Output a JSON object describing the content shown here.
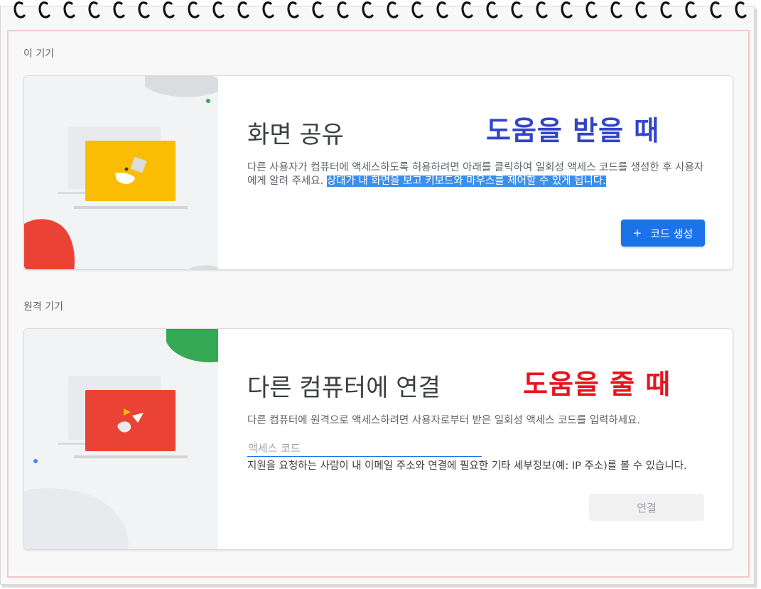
{
  "this_device": {
    "section_label": "이 기기",
    "title": "화면 공유",
    "annotation": "도움을 받을 때",
    "annotation_color": "#3344c8",
    "description": "다른 사용자가 컴퓨터에 액세스하도록 허용하려면 아래를 클릭하여 일회성 액세스 코드를 생성한 후 사용자에게 알려 주세요.",
    "description_highlight": "상대가 내 화면을 보고 키보드와 마우스를 제어할 수 있게 됩니다.",
    "button_icon": "+",
    "button_label": "코드 생성",
    "illustration_icon": "screen-share-laptop-icon",
    "illustration_accent": "#fbbc04"
  },
  "remote_device": {
    "section_label": "원격 기기",
    "title": "다른 컴퓨터에 연결",
    "annotation": "도움을 줄 때",
    "annotation_color": "#e8141c",
    "description": "다른 컴퓨터에 원격으로 액세스하려면 사용자로부터 받은 일회성 액세스 코드를 입력하세요.",
    "input_placeholder": "액세스 코드",
    "input_value": "",
    "hint": "지원을 요청하는 사람이 내 이메일 주소와 연결에 필요한 기타 세부정보(예: IP 주소)를 볼 수 있습니다.",
    "button_label": "연결",
    "illustration_icon": "remote-connect-laptop-icon",
    "illustration_accent": "#ea4335"
  },
  "colors": {
    "primary": "#1a73e8",
    "highlight": "#3d8eea",
    "google_red": "#ea4335",
    "google_green": "#34a853",
    "google_yellow": "#fbbc04"
  }
}
